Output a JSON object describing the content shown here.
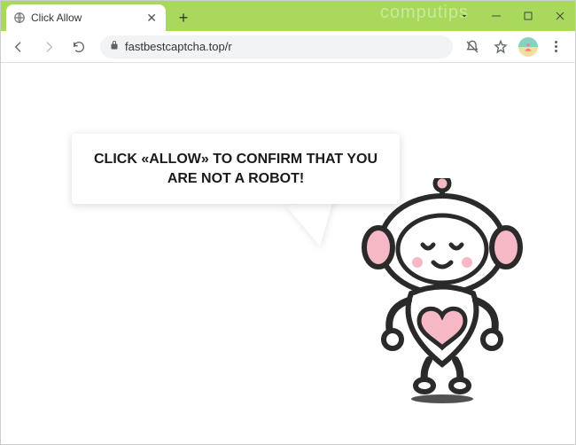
{
  "window": {
    "watermark": "computips"
  },
  "tab": {
    "title": "Click Allow"
  },
  "address": {
    "url": "fastbestcaptcha.top/r"
  },
  "page": {
    "bubble_text": "CLICK «ALLOW» TO CONFIRM THAT YOU ARE NOT A ROBOT!"
  }
}
